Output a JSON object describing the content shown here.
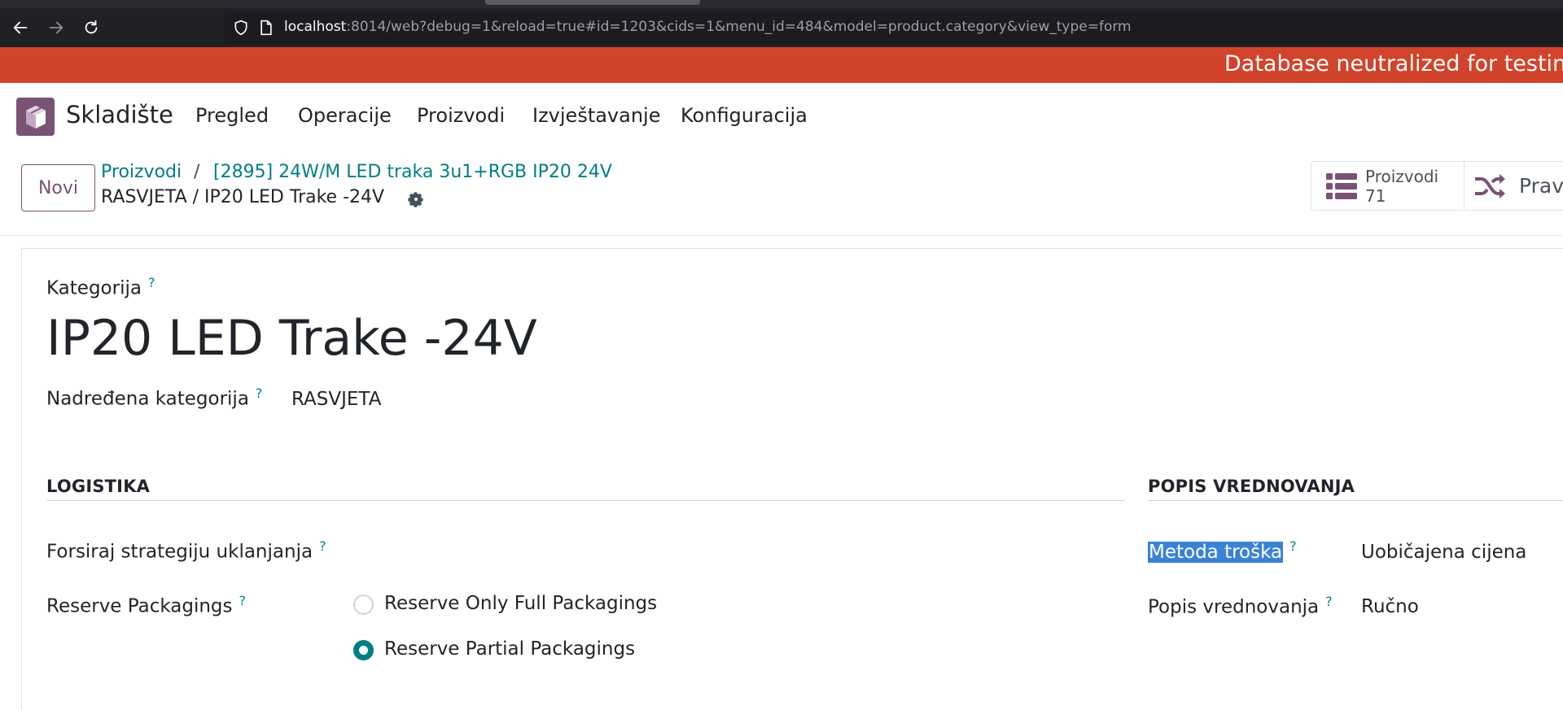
{
  "browser": {
    "url_host": "localhost",
    "url_rest": ":8014/web?debug=1&reload=true#id=1203&cids=1&menu_id=484&model=product.category&view_type=form"
  },
  "banner": {
    "text": "Database neutralized for testing"
  },
  "navbar": {
    "app_name": "Skladište",
    "menu": [
      "Pregled",
      "Operacije",
      "Proizvodi",
      "Izvještavanje",
      "Konfiguracija"
    ]
  },
  "control_panel": {
    "new_label": "Novi",
    "breadcrumb": [
      "Proizvodi",
      "/",
      "[2895] 24W/M LED traka 3u1+RGB IP20 24V"
    ],
    "current": "RASVJETA / IP20 LED Trake -24V",
    "stat_products_label": "Proizvodi",
    "stat_products_count": "71",
    "stat_rules_label": "Pravila"
  },
  "form": {
    "category_label": "Kategorija",
    "help_mark": "?",
    "category_name": "IP20 LED Trake -24V",
    "parent_label": "Nadređena kategorija",
    "parent_value": "RASVJETA",
    "logistics_title": "LOGISTIKA",
    "removal_label": "Forsiraj strategiju uklanjanja",
    "packaging_label": "Reserve Packagings",
    "packaging_options": [
      "Reserve Only Full Packagings",
      "Reserve Partial Packagings"
    ],
    "packaging_selected": "Reserve Partial Packagings",
    "valuation_title": "POPIS VREDNOVANJA",
    "cost_method_label": "Metoda troška",
    "cost_method_value": "Uobičajena cijena",
    "valuation_label": "Popis vrednovanja",
    "valuation_value": "Ručno"
  },
  "colors": {
    "banner": "#d1432b",
    "accent": "#017e84",
    "brand": "#7a5273",
    "browser": "#202124"
  }
}
